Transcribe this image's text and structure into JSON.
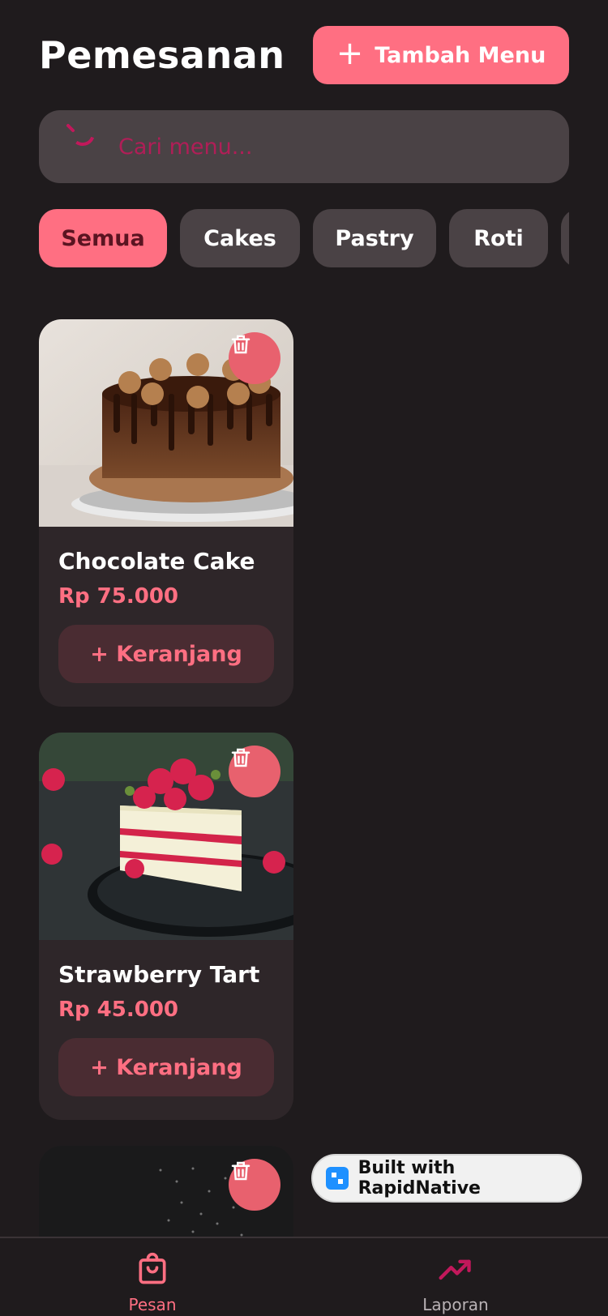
{
  "header": {
    "title": "Pemesanan",
    "add_button_label": "Tambah Menu"
  },
  "search": {
    "placeholder": "Cari menu..."
  },
  "categories": [
    {
      "label": "Semua",
      "active": true
    },
    {
      "label": "Cakes",
      "active": false
    },
    {
      "label": "Pastry",
      "active": false
    },
    {
      "label": "Roti",
      "active": false
    },
    {
      "label": "",
      "active": false
    }
  ],
  "menu_items": [
    {
      "name": "Chocolate Cake",
      "price": "Rp 75.000",
      "cart_label": "+ Keranjang",
      "image": "chocolate-cake-photo"
    },
    {
      "name": "Strawberry Tart",
      "price": "Rp 45.000",
      "cart_label": "+ Keranjang",
      "image": "strawberry-tart-photo"
    },
    {
      "name": "",
      "price": "",
      "cart_label": "",
      "image": "flour-dusting-photo"
    }
  ],
  "badge": {
    "label": "Built with RapidNative"
  },
  "bottom_nav": {
    "items": [
      {
        "label": "Pesan",
        "icon": "shopping-bag-icon",
        "active": true
      },
      {
        "label": "Laporan",
        "icon": "trending-up-icon",
        "active": false
      }
    ]
  },
  "colors": {
    "background": "#1f1b1d",
    "accent": "#ff6f82",
    "surface": "#4a4245",
    "card": "#2e2629",
    "delete": "#e8616e"
  }
}
